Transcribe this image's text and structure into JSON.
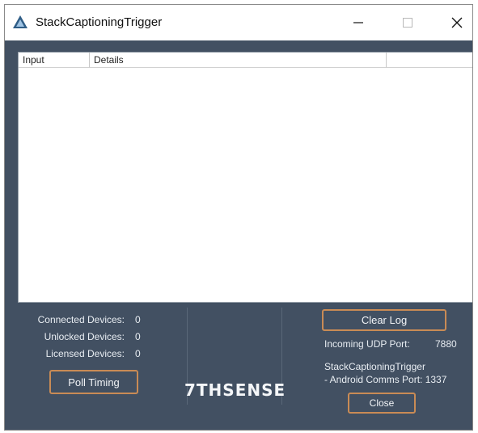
{
  "window": {
    "title": "StackCaptioningTrigger",
    "controls": {
      "minimize": "—",
      "maximize": "☐",
      "close": "✕"
    }
  },
  "log": {
    "columns": [
      "Input",
      "Details",
      ""
    ],
    "rows": []
  },
  "stats": {
    "connected_label": "Connected Devices:",
    "connected_value": "0",
    "unlocked_label": "Unlocked Devices:",
    "unlocked_value": "0",
    "licensed_label": "Licensed Devices:",
    "licensed_value": "0"
  },
  "buttons": {
    "poll_timing": "Poll Timing",
    "clear_log": "Clear Log",
    "close": "Close"
  },
  "brand": {
    "logo": "7THSENSE"
  },
  "info": {
    "udp_label": "Incoming UDP Port:",
    "udp_value": "7880",
    "android_line1": "StackCaptioningTrigger",
    "android_line2": "- Android Comms Port: 1337"
  },
  "colors": {
    "panel_bg": "#425062",
    "button_border": "#c98b55",
    "accent_logo": "#4a8fc7"
  },
  "icons": {
    "app": "app-triangle-icon"
  }
}
